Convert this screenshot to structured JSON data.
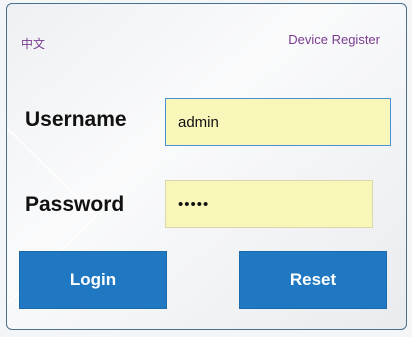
{
  "header": {
    "language_link": "中文",
    "register_link": "Device Register"
  },
  "form": {
    "username_label": "Username",
    "username_value": "admin",
    "password_label": "Password",
    "password_value": "•••••"
  },
  "buttons": {
    "login_label": "Login",
    "reset_label": "Reset"
  },
  "colors": {
    "accent": "#1f78c1",
    "input_bg": "#f8f6b8",
    "link": "#7a3b8f"
  }
}
